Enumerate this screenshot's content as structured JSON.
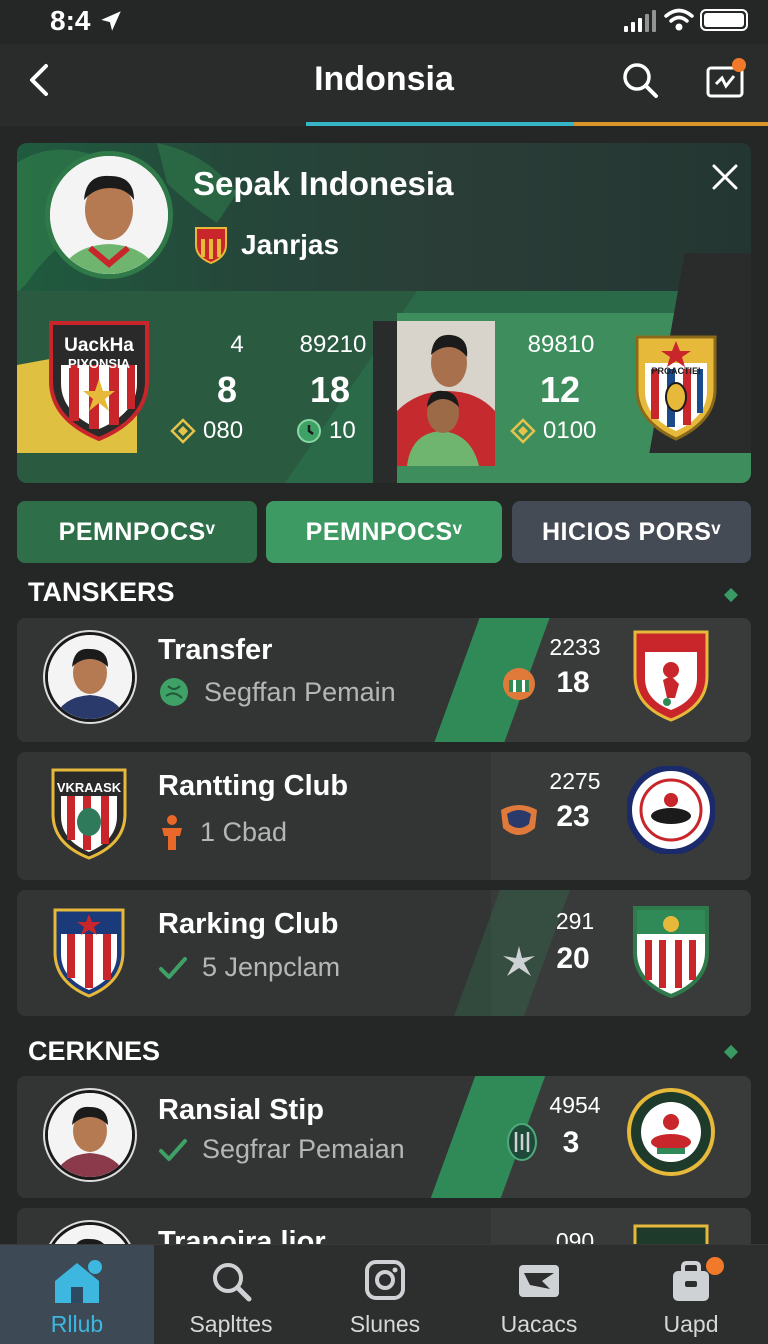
{
  "status": {
    "time": "8:4"
  },
  "header": {
    "title": "Indonsia"
  },
  "hero": {
    "name": "Sepak Indonesia",
    "subtitle": "Janrjas",
    "left_crest_text_1": "UackHa",
    "left_crest_text_2": "PIXONSIA",
    "stats": [
      {
        "top": "4",
        "big": "8",
        "bottom": "080"
      },
      {
        "top": "89210",
        "big": "18",
        "bottom": "10"
      },
      {
        "top": "89810",
        "big": "12",
        "bottom": "0100"
      }
    ],
    "right_crest_text": "PROACTIEI"
  },
  "chips": [
    {
      "label": "PEMNPOCSᵛ"
    },
    {
      "label": "PEMNPOCSᵛ"
    },
    {
      "label": "HICIOS PORSᵛ"
    }
  ],
  "sections": {
    "transfers": "TANSKERS",
    "second": "CERKNES"
  },
  "rows": [
    {
      "title": "Transfer",
      "subtitle": "Segffan Pemain",
      "stat_top": "2233",
      "stat_big": "18"
    },
    {
      "title": "Rantting Club",
      "subtitle": "1 Cbad",
      "stat_top": "2275",
      "stat_big": "23",
      "crest_text": "VKRAASK"
    },
    {
      "title": "Rarking Club",
      "subtitle": "5 Jenpclam",
      "stat_top": "291",
      "stat_big": "20"
    },
    {
      "title": "Ransial Stip",
      "subtitle": "Segfrar Pemaian",
      "stat_top": "4954",
      "stat_big": "3"
    },
    {
      "title": "Tranoira lior",
      "stat_top": "090"
    }
  ],
  "nav": [
    {
      "label": "Rllub",
      "icon": "home-icon"
    },
    {
      "label": "Saplttes",
      "icon": "search-icon"
    },
    {
      "label": "Slunes",
      "icon": "instagram-icon"
    },
    {
      "label": "Uacacs",
      "icon": "inbox-icon"
    },
    {
      "label": "Uapd",
      "icon": "bag-icon"
    }
  ],
  "colors": {
    "background": "#252626",
    "accent_green": "#3d9a62",
    "nav_active": "#3db7e0",
    "notification": "#f07a2a"
  }
}
